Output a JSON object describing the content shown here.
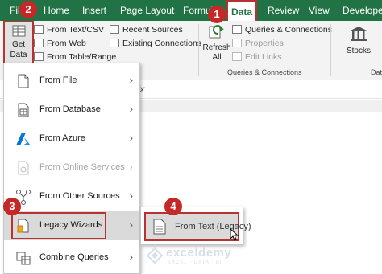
{
  "tabs": [
    "File",
    "Home",
    "Insert",
    "Page Layout",
    "Formulas",
    "Data",
    "Review",
    "View",
    "Developer"
  ],
  "active_tab": "Data",
  "ribbon": {
    "get_data_line1": "Get",
    "get_data_line2": "Data",
    "get_transform": [
      "From Text/CSV",
      "From Web",
      "From Table/Range"
    ],
    "recent_sources": "Recent Sources",
    "existing_connections": "Existing Connections",
    "refresh_line1": "Refresh",
    "refresh_line2": "All",
    "queries_connections": "Queries & Connections",
    "properties": "Properties",
    "edit_links": "Edit Links",
    "group_queries_label": "Queries & Connections",
    "stocks": "Stocks",
    "data_types_label": "Dat"
  },
  "formula_bar": {
    "fx": "fx"
  },
  "menu": {
    "items": [
      {
        "label": "From File",
        "enabled": true,
        "icon": "file-icon"
      },
      {
        "label": "From Database",
        "enabled": true,
        "icon": "database-icon"
      },
      {
        "label": "From Azure",
        "enabled": true,
        "icon": "azure-icon"
      },
      {
        "label": "From Online Services",
        "enabled": false,
        "icon": "online-services-icon"
      },
      {
        "label": "From Other Sources",
        "enabled": true,
        "icon": "other-sources-icon"
      },
      {
        "label": "Legacy Wizards",
        "enabled": true,
        "icon": "legacy-wizards-icon"
      },
      {
        "label": "Combine Queries",
        "enabled": true,
        "icon": "combine-queries-icon"
      }
    ]
  },
  "submenu": {
    "item": "From Text (Legacy)"
  },
  "callouts": [
    "1",
    "2",
    "3",
    "4"
  ],
  "watermark": {
    "name": "exceldemy",
    "tagline": "EXCEL · DATA · BI"
  },
  "colors": {
    "excel_green": "#217346",
    "callout_red": "#c62828",
    "highlight_border": "#b83232",
    "hover_grey": "#dadada"
  }
}
